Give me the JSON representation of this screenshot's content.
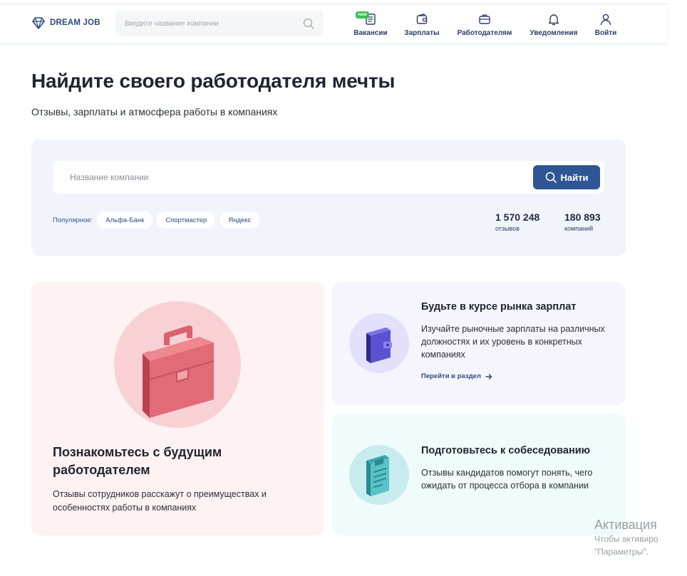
{
  "header": {
    "logo_text": "DREAM JOB",
    "search_placeholder": "Введите название компании",
    "nav": [
      {
        "label": "Вакансии",
        "badge": "new"
      },
      {
        "label": "Зарплаты"
      },
      {
        "label": "Работодателям"
      },
      {
        "label": "Уведомления"
      },
      {
        "label": "Войти"
      }
    ]
  },
  "hero": {
    "title": "Найдите своего работодателя мечты",
    "subtitle": "Отзывы, зарплаты и атмосфера работы в компаниях"
  },
  "search": {
    "placeholder": "Название компании",
    "button_label": "Найти",
    "popular_label": "Популярное:",
    "popular": [
      "Альфа-Банк",
      "Спортмастер",
      "Яндекс"
    ],
    "stats": [
      {
        "value": "1 570 248",
        "caption": "отзывов"
      },
      {
        "value": "180 893",
        "caption": "компаний"
      }
    ]
  },
  "cards": {
    "employer": {
      "title": "Познакомьтесь с будущим работодателем",
      "text": "Отзывы сотрудников расскажут о преимуществах и особенностях работы в компаниях",
      "icon": "briefcase-icon"
    },
    "salary": {
      "title": "Будьте в курсе рынка зарплат",
      "text": "Изучайте рыночные зарплаты на различных должностях и их уровень в конкретных компаниях",
      "link": "Перейти в раздел",
      "icon": "wallet-icon"
    },
    "interview": {
      "title": "Подготовьтесь к собеседованию",
      "text": "Отзывы кандидатов помогут понять, чего ожидать от процесса отбора в компании",
      "icon": "clipboard-icon"
    }
  },
  "watermark": {
    "line1": "Активация",
    "line2": "Чтобы активиро",
    "line3": "\"Параметры\"."
  },
  "colors": {
    "accent": "#2e5596",
    "badge_new": "#3fbf55",
    "panel_bg": "#f1f5fb",
    "card_pink": "#fef2f3",
    "card_lavender": "#f6f5fd",
    "card_mint": "#f0fbfb"
  }
}
